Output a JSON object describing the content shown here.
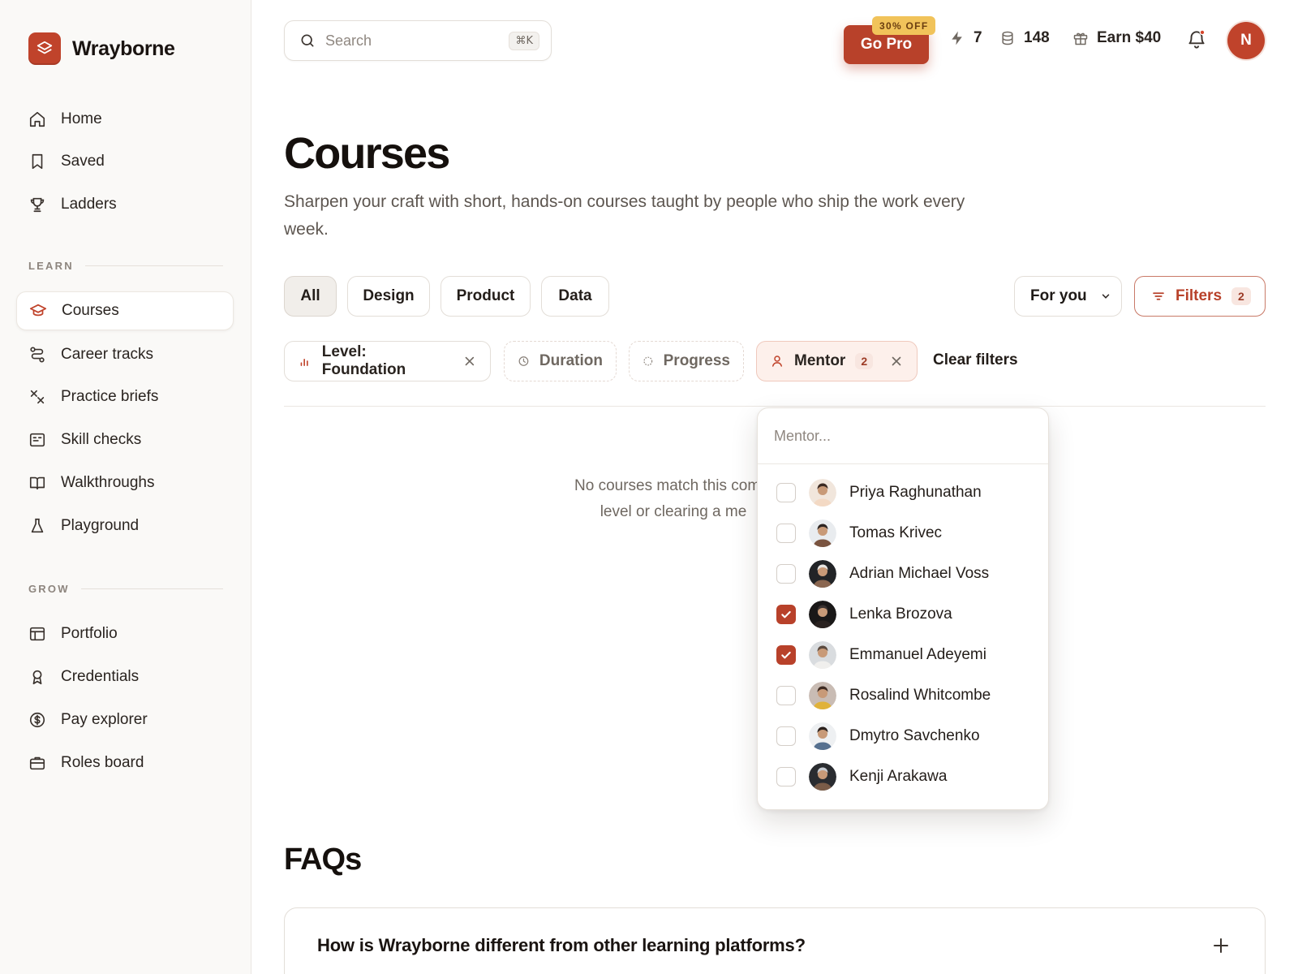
{
  "brand": {
    "name": "Wrayborne"
  },
  "colors": {
    "accent": "#b8412a",
    "brand": "#c0432b",
    "badge": "#f1c35a"
  },
  "sidebar": {
    "primary": [
      {
        "label": "Home",
        "icon": "home-icon"
      },
      {
        "label": "Saved",
        "icon": "bookmark-icon"
      },
      {
        "label": "Ladders",
        "icon": "trophy-icon"
      }
    ],
    "learn_label": "LEARN",
    "learn": [
      {
        "label": "Courses",
        "icon": "graduation-cap-icon",
        "active": true
      },
      {
        "label": "Career tracks",
        "icon": "route-icon"
      },
      {
        "label": "Practice briefs",
        "icon": "tools-icon"
      },
      {
        "label": "Skill checks",
        "icon": "checklist-icon"
      },
      {
        "label": "Walkthroughs",
        "icon": "book-open-icon"
      },
      {
        "label": "Playground",
        "icon": "flask-icon"
      }
    ],
    "grow_label": "GROW",
    "grow": [
      {
        "label": "Portfolio",
        "icon": "layout-icon"
      },
      {
        "label": "Credentials",
        "icon": "award-icon"
      },
      {
        "label": "Pay explorer",
        "icon": "dollar-icon"
      },
      {
        "label": "Roles board",
        "icon": "briefcase-icon"
      }
    ]
  },
  "topbar": {
    "search_placeholder": "Search",
    "search_shortcut": "⌘K",
    "gopro_label": "Go Pro",
    "gopro_badge": "30% OFF",
    "streak": "7",
    "coins": "148",
    "earn": "Earn $40",
    "avatar_initial": "N"
  },
  "page": {
    "title": "Courses",
    "subtitle": "Sharpen your craft with short, hands-on courses taught by people who ship the work every week."
  },
  "categories": [
    "All",
    "Design",
    "Product",
    "Data"
  ],
  "sort": {
    "label": "For you"
  },
  "filters": {
    "label": "Filters",
    "count": "2"
  },
  "chips": {
    "level": "Level: Foundation",
    "duration": "Duration",
    "progress": "Progress",
    "mentor": "Mentor",
    "mentor_count": "2",
    "clear": "Clear filters"
  },
  "empty": {
    "line1": "No courses match this combi",
    "line2": "level or clearing a me"
  },
  "mentor_dropdown": {
    "placeholder": "Mentor...",
    "options": [
      {
        "name": "Priya Raghunathan",
        "checked": false
      },
      {
        "name": "Tomas Krivec",
        "checked": false
      },
      {
        "name": "Adrian Michael Voss",
        "checked": false
      },
      {
        "name": "Lenka Brozova",
        "checked": true
      },
      {
        "name": "Emmanuel Adeyemi",
        "checked": true
      },
      {
        "name": "Rosalind Whitcombe",
        "checked": false
      },
      {
        "name": "Dmytro Savchenko",
        "checked": false
      },
      {
        "name": "Kenji Arakawa",
        "checked": false
      }
    ]
  },
  "faq": {
    "title": "FAQs",
    "question": "How is Wrayborne different from other learning platforms?"
  }
}
